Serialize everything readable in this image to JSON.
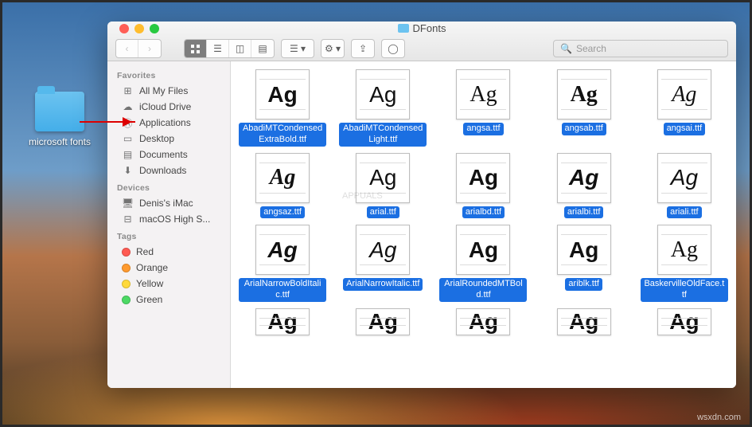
{
  "desktop": {
    "folder_label": "microsoft fonts"
  },
  "window_title": "DFonts",
  "search": {
    "placeholder": "Search"
  },
  "sidebar": {
    "favorites_heading": "Favorites",
    "favorites": [
      "All My Files",
      "iCloud Drive",
      "Applications",
      "Desktop",
      "Documents",
      "Downloads"
    ],
    "devices_heading": "Devices",
    "devices": [
      "Denis's iMac",
      "macOS High S..."
    ],
    "tags_heading": "Tags",
    "tags": [
      {
        "label": "Red",
        "color": "#ff5a52"
      },
      {
        "label": "Orange",
        "color": "#ff9a2e"
      },
      {
        "label": "Yellow",
        "color": "#ffd93a"
      },
      {
        "label": "Green",
        "color": "#4cd964"
      }
    ]
  },
  "files": [
    {
      "name": "AbadiMTCondensedExtraBold.ttf",
      "style": "font-weight:900;font-style:normal;"
    },
    {
      "name": "AbadiMTCondensedLight.ttf",
      "style": "font-weight:300;font-style:normal;"
    },
    {
      "name": "angsa.ttf",
      "style": "font-weight:400;font-style:normal;font-family:Georgia,serif;"
    },
    {
      "name": "angsab.ttf",
      "style": "font-weight:700;font-style:normal;font-family:Georgia,serif;"
    },
    {
      "name": "angsai.ttf",
      "style": "font-weight:400;font-style:italic;font-family:Georgia,serif;"
    },
    {
      "name": "angsaz.ttf",
      "style": "font-weight:700;font-style:italic;font-family:Georgia,serif;"
    },
    {
      "name": "arial.ttf",
      "style": "font-weight:400;font-family:Arial,sans-serif;"
    },
    {
      "name": "arialbd.ttf",
      "style": "font-weight:700;font-family:Arial,sans-serif;"
    },
    {
      "name": "arialbi.ttf",
      "style": "font-weight:700;font-style:italic;font-family:Arial,sans-serif;"
    },
    {
      "name": "ariali.ttf",
      "style": "font-weight:400;font-style:italic;font-family:Arial,sans-serif;"
    },
    {
      "name": "ArialNarrowBoldItalic.ttf",
      "style": "font-weight:700;font-style:italic;font-family:'Arial Narrow',Arial,sans-serif;"
    },
    {
      "name": "ArialNarrowItalic.ttf",
      "style": "font-weight:400;font-style:italic;font-family:'Arial Narrow',Arial,sans-serif;"
    },
    {
      "name": "ArialRoundedMTBold.ttf",
      "style": "font-weight:700;font-family:Arial,sans-serif;"
    },
    {
      "name": "ariblk.ttf",
      "style": "font-weight:900;font-family:Arial,sans-serif;"
    },
    {
      "name": "BaskervilleOldFace.ttf",
      "style": "font-weight:400;font-family:Georgia,serif;"
    }
  ],
  "cutoff_row_count": 5,
  "watermark": "wsxdn.com",
  "center_watermark": "APPUALS"
}
